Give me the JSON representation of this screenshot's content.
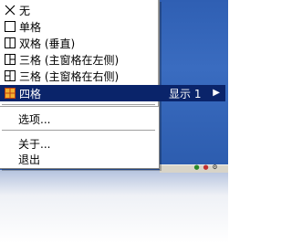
{
  "submenu": {
    "items": [
      {
        "label": "无",
        "icon": "none-layout-icon",
        "selected": false
      },
      {
        "label": "单格",
        "icon": "single-pane-icon",
        "selected": false
      },
      {
        "label": "双格 (垂直)",
        "icon": "two-pane-vertical-icon",
        "selected": false
      },
      {
        "label": "三格 (主窗格在左侧)",
        "icon": "three-pane-left-icon",
        "selected": false
      },
      {
        "label": "三格 (主窗格在右侧)",
        "icon": "three-pane-right-icon",
        "selected": false
      },
      {
        "label": "四格",
        "icon": "four-pane-icon",
        "selected": true
      }
    ]
  },
  "menu": {
    "display_label": "显示 1",
    "display_arrow": "▶",
    "options_label": "选项...",
    "about_label": "关于...",
    "exit_label": "退出"
  },
  "colors": {
    "highlight": "#0a246a",
    "desktop": "#3a6cc0",
    "four_pane_icon": "#e8a020"
  }
}
